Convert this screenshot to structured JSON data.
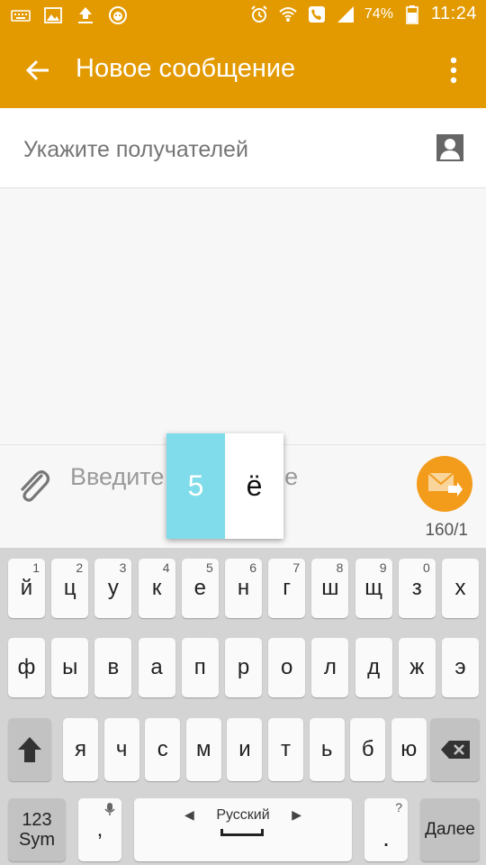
{
  "status_bar": {
    "icons_left": [
      "keyboard-icon",
      "image-icon",
      "upload-icon",
      "lion-app-icon"
    ],
    "icons_right": [
      "alarm-icon",
      "wifi-icon",
      "call-icon",
      "signal-icon",
      "battery-icon"
    ],
    "battery": "74%",
    "time": "11:24"
  },
  "app_bar": {
    "title": "Новое сообщение",
    "color": "#e39a00"
  },
  "recipient": {
    "placeholder": "Укажите получателей"
  },
  "compose": {
    "placeholder": "Введите сообщение",
    "counter": "160/1",
    "send_color": "#f39c1c"
  },
  "popup": {
    "primary": "5",
    "alternate": "ё"
  },
  "keyboard": {
    "row1": [
      {
        "label": "й",
        "hint": "1"
      },
      {
        "label": "ц",
        "hint": "2"
      },
      {
        "label": "у",
        "hint": "3"
      },
      {
        "label": "к",
        "hint": "4"
      },
      {
        "label": "е",
        "hint": "5"
      },
      {
        "label": "н",
        "hint": "6"
      },
      {
        "label": "г",
        "hint": "7"
      },
      {
        "label": "ш",
        "hint": "8"
      },
      {
        "label": "щ",
        "hint": "9"
      },
      {
        "label": "з",
        "hint": "0"
      },
      {
        "label": "х",
        "hint": ""
      }
    ],
    "row2": [
      "ф",
      "ы",
      "в",
      "а",
      "п",
      "р",
      "о",
      "л",
      "д",
      "ж",
      "э"
    ],
    "row3": [
      "я",
      "ч",
      "с",
      "м",
      "и",
      "т",
      "ь",
      "б",
      "ю"
    ],
    "sym_label_1": "123",
    "sym_label_2": "Sym",
    "comma": ",",
    "space_label": "Русский",
    "period": ".",
    "period_hint": "?",
    "enter_label": "Далее"
  }
}
